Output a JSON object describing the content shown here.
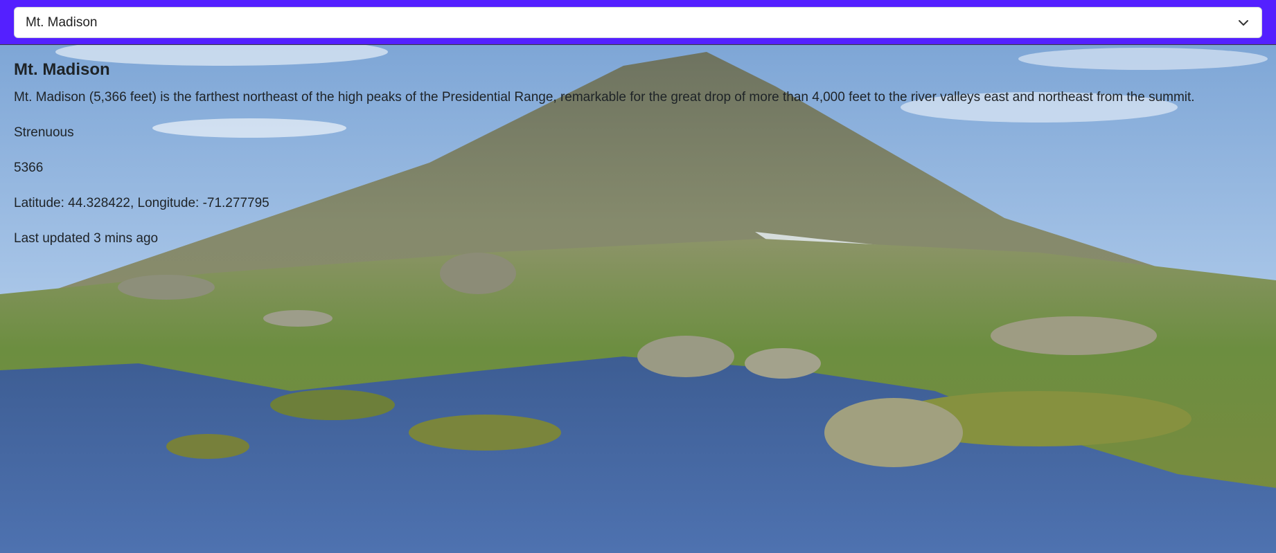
{
  "peak_select": {
    "selected": "Mt. Madison",
    "icon": "chevron-down-icon"
  },
  "peak": {
    "name": "Mt. Madison",
    "description": "Mt. Madison (5,366 feet) is the farthest northeast of the high peaks of the Presidential Range, remarkable for the great drop of more than 4,000 feet to the river valleys east and northeast from the summit.",
    "difficulty": "Strenuous",
    "elevation": "5366",
    "coordinates": "Latitude: 44.328422, Longitude: -71.277795",
    "last_updated": "Last updated 3 mins ago"
  },
  "colors": {
    "accent": "#5420ff",
    "sky": "#8fb6e2",
    "mountain": "#7b8065",
    "grass": "#6f8f45",
    "water": "#3a5f9c"
  }
}
